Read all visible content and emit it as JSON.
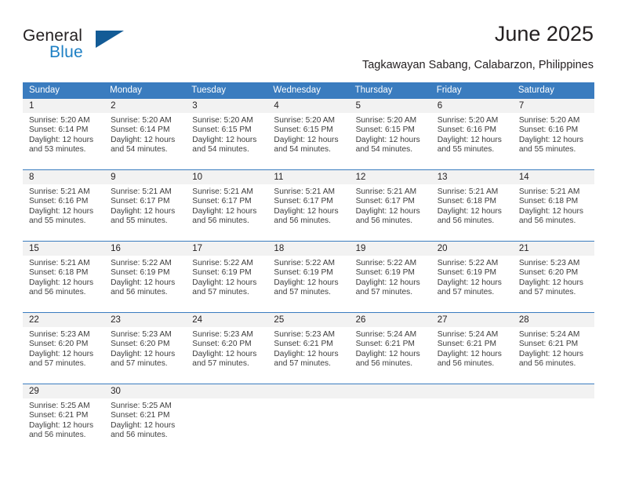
{
  "brand": {
    "word_general": "General",
    "word_blue": "Blue",
    "triangle_color": "#135b96",
    "blue_color": "#1c7fc4"
  },
  "header": {
    "title": "June 2025",
    "location": "Tagkawayan Sabang, Calabarzon, Philippines"
  },
  "theme": {
    "header_bg": "#3a7cbf",
    "daynum_bg": "#f2f2f2",
    "text": "#231f20"
  },
  "calendar": {
    "weekday_headers": [
      "Sunday",
      "Monday",
      "Tuesday",
      "Wednesday",
      "Thursday",
      "Friday",
      "Saturday"
    ],
    "weeks": [
      [
        {
          "day": "1",
          "sunrise": "Sunrise: 5:20 AM",
          "sunset": "Sunset: 6:14 PM",
          "daylight": "Daylight: 12 hours and 53 minutes."
        },
        {
          "day": "2",
          "sunrise": "Sunrise: 5:20 AM",
          "sunset": "Sunset: 6:14 PM",
          "daylight": "Daylight: 12 hours and 54 minutes."
        },
        {
          "day": "3",
          "sunrise": "Sunrise: 5:20 AM",
          "sunset": "Sunset: 6:15 PM",
          "daylight": "Daylight: 12 hours and 54 minutes."
        },
        {
          "day": "4",
          "sunrise": "Sunrise: 5:20 AM",
          "sunset": "Sunset: 6:15 PM",
          "daylight": "Daylight: 12 hours and 54 minutes."
        },
        {
          "day": "5",
          "sunrise": "Sunrise: 5:20 AM",
          "sunset": "Sunset: 6:15 PM",
          "daylight": "Daylight: 12 hours and 54 minutes."
        },
        {
          "day": "6",
          "sunrise": "Sunrise: 5:20 AM",
          "sunset": "Sunset: 6:16 PM",
          "daylight": "Daylight: 12 hours and 55 minutes."
        },
        {
          "day": "7",
          "sunrise": "Sunrise: 5:20 AM",
          "sunset": "Sunset: 6:16 PM",
          "daylight": "Daylight: 12 hours and 55 minutes."
        }
      ],
      [
        {
          "day": "8",
          "sunrise": "Sunrise: 5:21 AM",
          "sunset": "Sunset: 6:16 PM",
          "daylight": "Daylight: 12 hours and 55 minutes."
        },
        {
          "day": "9",
          "sunrise": "Sunrise: 5:21 AM",
          "sunset": "Sunset: 6:17 PM",
          "daylight": "Daylight: 12 hours and 55 minutes."
        },
        {
          "day": "10",
          "sunrise": "Sunrise: 5:21 AM",
          "sunset": "Sunset: 6:17 PM",
          "daylight": "Daylight: 12 hours and 56 minutes."
        },
        {
          "day": "11",
          "sunrise": "Sunrise: 5:21 AM",
          "sunset": "Sunset: 6:17 PM",
          "daylight": "Daylight: 12 hours and 56 minutes."
        },
        {
          "day": "12",
          "sunrise": "Sunrise: 5:21 AM",
          "sunset": "Sunset: 6:17 PM",
          "daylight": "Daylight: 12 hours and 56 minutes."
        },
        {
          "day": "13",
          "sunrise": "Sunrise: 5:21 AM",
          "sunset": "Sunset: 6:18 PM",
          "daylight": "Daylight: 12 hours and 56 minutes."
        },
        {
          "day": "14",
          "sunrise": "Sunrise: 5:21 AM",
          "sunset": "Sunset: 6:18 PM",
          "daylight": "Daylight: 12 hours and 56 minutes."
        }
      ],
      [
        {
          "day": "15",
          "sunrise": "Sunrise: 5:21 AM",
          "sunset": "Sunset: 6:18 PM",
          "daylight": "Daylight: 12 hours and 56 minutes."
        },
        {
          "day": "16",
          "sunrise": "Sunrise: 5:22 AM",
          "sunset": "Sunset: 6:19 PM",
          "daylight": "Daylight: 12 hours and 56 minutes."
        },
        {
          "day": "17",
          "sunrise": "Sunrise: 5:22 AM",
          "sunset": "Sunset: 6:19 PM",
          "daylight": "Daylight: 12 hours and 57 minutes."
        },
        {
          "day": "18",
          "sunrise": "Sunrise: 5:22 AM",
          "sunset": "Sunset: 6:19 PM",
          "daylight": "Daylight: 12 hours and 57 minutes."
        },
        {
          "day": "19",
          "sunrise": "Sunrise: 5:22 AM",
          "sunset": "Sunset: 6:19 PM",
          "daylight": "Daylight: 12 hours and 57 minutes."
        },
        {
          "day": "20",
          "sunrise": "Sunrise: 5:22 AM",
          "sunset": "Sunset: 6:19 PM",
          "daylight": "Daylight: 12 hours and 57 minutes."
        },
        {
          "day": "21",
          "sunrise": "Sunrise: 5:23 AM",
          "sunset": "Sunset: 6:20 PM",
          "daylight": "Daylight: 12 hours and 57 minutes."
        }
      ],
      [
        {
          "day": "22",
          "sunrise": "Sunrise: 5:23 AM",
          "sunset": "Sunset: 6:20 PM",
          "daylight": "Daylight: 12 hours and 57 minutes."
        },
        {
          "day": "23",
          "sunrise": "Sunrise: 5:23 AM",
          "sunset": "Sunset: 6:20 PM",
          "daylight": "Daylight: 12 hours and 57 minutes."
        },
        {
          "day": "24",
          "sunrise": "Sunrise: 5:23 AM",
          "sunset": "Sunset: 6:20 PM",
          "daylight": "Daylight: 12 hours and 57 minutes."
        },
        {
          "day": "25",
          "sunrise": "Sunrise: 5:23 AM",
          "sunset": "Sunset: 6:21 PM",
          "daylight": "Daylight: 12 hours and 57 minutes."
        },
        {
          "day": "26",
          "sunrise": "Sunrise: 5:24 AM",
          "sunset": "Sunset: 6:21 PM",
          "daylight": "Daylight: 12 hours and 56 minutes."
        },
        {
          "day": "27",
          "sunrise": "Sunrise: 5:24 AM",
          "sunset": "Sunset: 6:21 PM",
          "daylight": "Daylight: 12 hours and 56 minutes."
        },
        {
          "day": "28",
          "sunrise": "Sunrise: 5:24 AM",
          "sunset": "Sunset: 6:21 PM",
          "daylight": "Daylight: 12 hours and 56 minutes."
        }
      ],
      [
        {
          "day": "29",
          "sunrise": "Sunrise: 5:25 AM",
          "sunset": "Sunset: 6:21 PM",
          "daylight": "Daylight: 12 hours and 56 minutes."
        },
        {
          "day": "30",
          "sunrise": "Sunrise: 5:25 AM",
          "sunset": "Sunset: 6:21 PM",
          "daylight": "Daylight: 12 hours and 56 minutes."
        },
        {
          "day": "",
          "sunrise": "",
          "sunset": "",
          "daylight": ""
        },
        {
          "day": "",
          "sunrise": "",
          "sunset": "",
          "daylight": ""
        },
        {
          "day": "",
          "sunrise": "",
          "sunset": "",
          "daylight": ""
        },
        {
          "day": "",
          "sunrise": "",
          "sunset": "",
          "daylight": ""
        },
        {
          "day": "",
          "sunrise": "",
          "sunset": "",
          "daylight": ""
        }
      ]
    ]
  }
}
